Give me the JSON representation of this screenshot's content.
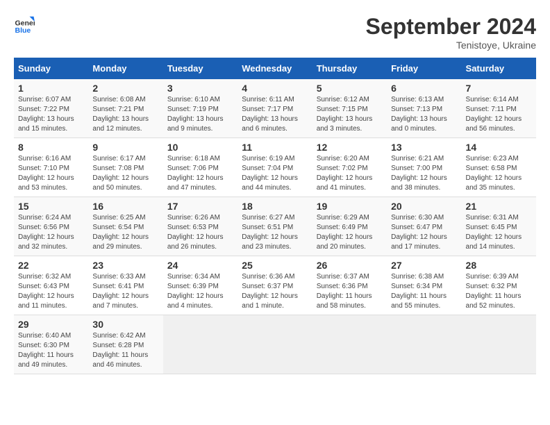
{
  "header": {
    "logo_text_general": "General",
    "logo_text_blue": "Blue",
    "month_title": "September 2024",
    "location": "Tenistoye, Ukraine"
  },
  "weekdays": [
    "Sunday",
    "Monday",
    "Tuesday",
    "Wednesday",
    "Thursday",
    "Friday",
    "Saturday"
  ],
  "weeks": [
    [
      {
        "day": "1",
        "sunrise": "6:07 AM",
        "sunset": "7:22 PM",
        "daylight": "13 hours and 15 minutes."
      },
      {
        "day": "2",
        "sunrise": "6:08 AM",
        "sunset": "7:21 PM",
        "daylight": "13 hours and 12 minutes."
      },
      {
        "day": "3",
        "sunrise": "6:10 AM",
        "sunset": "7:19 PM",
        "daylight": "13 hours and 9 minutes."
      },
      {
        "day": "4",
        "sunrise": "6:11 AM",
        "sunset": "7:17 PM",
        "daylight": "13 hours and 6 minutes."
      },
      {
        "day": "5",
        "sunrise": "6:12 AM",
        "sunset": "7:15 PM",
        "daylight": "13 hours and 3 minutes."
      },
      {
        "day": "6",
        "sunrise": "6:13 AM",
        "sunset": "7:13 PM",
        "daylight": "13 hours and 0 minutes."
      },
      {
        "day": "7",
        "sunrise": "6:14 AM",
        "sunset": "7:11 PM",
        "daylight": "12 hours and 56 minutes."
      }
    ],
    [
      {
        "day": "8",
        "sunrise": "6:16 AM",
        "sunset": "7:10 PM",
        "daylight": "12 hours and 53 minutes."
      },
      {
        "day": "9",
        "sunrise": "6:17 AM",
        "sunset": "7:08 PM",
        "daylight": "12 hours and 50 minutes."
      },
      {
        "day": "10",
        "sunrise": "6:18 AM",
        "sunset": "7:06 PM",
        "daylight": "12 hours and 47 minutes."
      },
      {
        "day": "11",
        "sunrise": "6:19 AM",
        "sunset": "7:04 PM",
        "daylight": "12 hours and 44 minutes."
      },
      {
        "day": "12",
        "sunrise": "6:20 AM",
        "sunset": "7:02 PM",
        "daylight": "12 hours and 41 minutes."
      },
      {
        "day": "13",
        "sunrise": "6:21 AM",
        "sunset": "7:00 PM",
        "daylight": "12 hours and 38 minutes."
      },
      {
        "day": "14",
        "sunrise": "6:23 AM",
        "sunset": "6:58 PM",
        "daylight": "12 hours and 35 minutes."
      }
    ],
    [
      {
        "day": "15",
        "sunrise": "6:24 AM",
        "sunset": "6:56 PM",
        "daylight": "12 hours and 32 minutes."
      },
      {
        "day": "16",
        "sunrise": "6:25 AM",
        "sunset": "6:54 PM",
        "daylight": "12 hours and 29 minutes."
      },
      {
        "day": "17",
        "sunrise": "6:26 AM",
        "sunset": "6:53 PM",
        "daylight": "12 hours and 26 minutes."
      },
      {
        "day": "18",
        "sunrise": "6:27 AM",
        "sunset": "6:51 PM",
        "daylight": "12 hours and 23 minutes."
      },
      {
        "day": "19",
        "sunrise": "6:29 AM",
        "sunset": "6:49 PM",
        "daylight": "12 hours and 20 minutes."
      },
      {
        "day": "20",
        "sunrise": "6:30 AM",
        "sunset": "6:47 PM",
        "daylight": "12 hours and 17 minutes."
      },
      {
        "day": "21",
        "sunrise": "6:31 AM",
        "sunset": "6:45 PM",
        "daylight": "12 hours and 14 minutes."
      }
    ],
    [
      {
        "day": "22",
        "sunrise": "6:32 AM",
        "sunset": "6:43 PM",
        "daylight": "12 hours and 11 minutes."
      },
      {
        "day": "23",
        "sunrise": "6:33 AM",
        "sunset": "6:41 PM",
        "daylight": "12 hours and 7 minutes."
      },
      {
        "day": "24",
        "sunrise": "6:34 AM",
        "sunset": "6:39 PM",
        "daylight": "12 hours and 4 minutes."
      },
      {
        "day": "25",
        "sunrise": "6:36 AM",
        "sunset": "6:37 PM",
        "daylight": "12 hours and 1 minute."
      },
      {
        "day": "26",
        "sunrise": "6:37 AM",
        "sunset": "6:36 PM",
        "daylight": "11 hours and 58 minutes."
      },
      {
        "day": "27",
        "sunrise": "6:38 AM",
        "sunset": "6:34 PM",
        "daylight": "11 hours and 55 minutes."
      },
      {
        "day": "28",
        "sunrise": "6:39 AM",
        "sunset": "6:32 PM",
        "daylight": "11 hours and 52 minutes."
      }
    ],
    [
      {
        "day": "29",
        "sunrise": "6:40 AM",
        "sunset": "6:30 PM",
        "daylight": "11 hours and 49 minutes."
      },
      {
        "day": "30",
        "sunrise": "6:42 AM",
        "sunset": "6:28 PM",
        "daylight": "11 hours and 46 minutes."
      },
      null,
      null,
      null,
      null,
      null
    ]
  ],
  "labels": {
    "sunrise": "Sunrise:",
    "sunset": "Sunset:",
    "daylight": "Daylight:"
  }
}
